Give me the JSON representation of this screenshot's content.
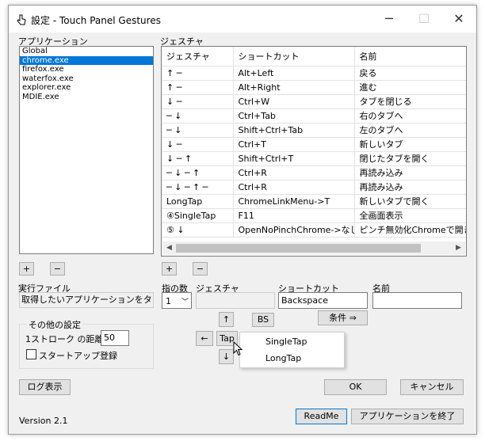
{
  "window": {
    "title": "設定 - Touch Panel Gestures",
    "min": "─",
    "max": "☐",
    "close": "✕"
  },
  "apps": {
    "label": "アプリケーション",
    "items": [
      "Global",
      "chrome.exe",
      "firefox.exe",
      "waterfox.exe",
      "explorer.exe",
      "MDIE.exe"
    ],
    "selected": 1,
    "add": "+",
    "remove": "−"
  },
  "gestures": {
    "label": "ジェスチャ",
    "columns": [
      "ジェスチャ",
      "ショートカット",
      "名前"
    ],
    "rows": [
      [
        "↑ ─",
        "Alt+Left",
        "戻る"
      ],
      [
        "↑ ─",
        "Alt+Right",
        "進む"
      ],
      [
        "↓ ─",
        "Ctrl+W",
        "タブを閉じる"
      ],
      [
        "─ ↓",
        "Ctrl+Tab",
        "右のタブへ"
      ],
      [
        "─ ↓",
        "Shift+Ctrl+Tab",
        "左のタブへ"
      ],
      [
        "↓ ─",
        "Ctrl+T",
        "新しいタブ"
      ],
      [
        "↓ ─ ↑",
        "Shift+Ctrl+T",
        "閉じたタブを開く"
      ],
      [
        "─ ↓ ─ ↑",
        "Ctrl+R",
        "再読み込み"
      ],
      [
        "─ ↓ ─ ↑ ─",
        "Ctrl+R",
        "再読み込み"
      ],
      [
        "LongTap",
        "ChromeLinkMenu->T",
        "新しいタブで開く"
      ],
      [
        "④SingleTap",
        "F11",
        "全画面表示"
      ],
      [
        "⑤ ↓",
        "OpenNoPinchChrome->なし",
        "ピンチ無効化Chromeで開き直す"
      ]
    ],
    "scroll_left": "◀",
    "scroll_right": "▶",
    "add": "+",
    "remove": "−"
  },
  "exec": {
    "label": "実行ファイル",
    "value": "取得したいアプリケーションをタッチ"
  },
  "other": {
    "title": "その他の設定",
    "stroke_label": "1ストローク の距離:",
    "stroke_value": "50",
    "startup_label": "スタートアップ登録"
  },
  "editor": {
    "fingers_label": "指の数",
    "fingers_value": "1",
    "gesture_label": "ジェスチャ",
    "shortcut_label": "ショートカット",
    "shortcut_value": "Backspace",
    "name_label": "名前",
    "name_value": "",
    "up": "↑",
    "down": "↓",
    "left": "←",
    "tap": "Tap",
    "bs": "BS",
    "condition": "条件 ⇒"
  },
  "tap_menu": [
    "SingleTap",
    "LongTap"
  ],
  "buttons": {
    "log": "ログ表示",
    "ok": "OK",
    "cancel": "キャンセル",
    "readme": "ReadMe",
    "exit": "アプリケーションを終了"
  },
  "version": "Version 2.1"
}
